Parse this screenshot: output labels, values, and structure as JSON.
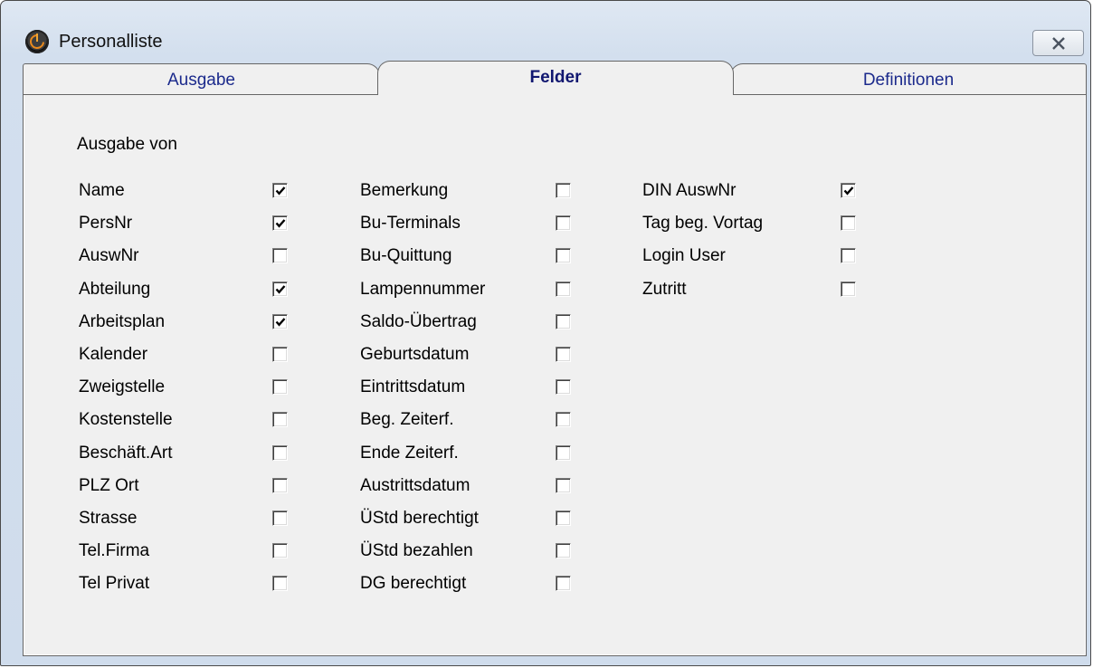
{
  "window": {
    "title": "Personalliste"
  },
  "tabs": [
    {
      "label": "Ausgabe",
      "active": false
    },
    {
      "label": "Felder",
      "active": true
    },
    {
      "label": "Definitionen",
      "active": false
    }
  ],
  "section": {
    "label": "Ausgabe von"
  },
  "columns": [
    {
      "fields": [
        {
          "label": "Name",
          "checked": true
        },
        {
          "label": "PersNr",
          "checked": true
        },
        {
          "label": "AuswNr",
          "checked": false
        },
        {
          "label": "Abteilung",
          "checked": true
        },
        {
          "label": "Arbeitsplan",
          "checked": true
        },
        {
          "label": "Kalender",
          "checked": false
        },
        {
          "label": "Zweigstelle",
          "checked": false
        },
        {
          "label": "Kostenstelle",
          "checked": false
        },
        {
          "label": "Beschäft.Art",
          "checked": false
        },
        {
          "label": "PLZ Ort",
          "checked": false
        },
        {
          "label": "Strasse",
          "checked": false
        },
        {
          "label": "Tel.Firma",
          "checked": false
        },
        {
          "label": "Tel Privat",
          "checked": false
        }
      ]
    },
    {
      "fields": [
        {
          "label": "Bemerkung",
          "checked": false
        },
        {
          "label": "Bu-Terminals",
          "checked": false
        },
        {
          "label": "Bu-Quittung",
          "checked": false
        },
        {
          "label": "Lampennummer",
          "checked": false
        },
        {
          "label": "Saldo-Übertrag",
          "checked": false
        },
        {
          "label": "Geburtsdatum",
          "checked": false
        },
        {
          "label": "Eintrittsdatum",
          "checked": false
        },
        {
          "label": "Beg. Zeiterf.",
          "checked": false
        },
        {
          "label": "Ende Zeiterf.",
          "checked": false
        },
        {
          "label": "Austrittsdatum",
          "checked": false
        },
        {
          "label": "ÜStd berechtigt",
          "checked": false
        },
        {
          "label": "ÜStd bezahlen",
          "checked": false
        },
        {
          "label": "DG berechtigt",
          "checked": false
        }
      ]
    },
    {
      "fields": [
        {
          "label": "DIN AuswNr",
          "checked": true
        },
        {
          "label": "Tag beg. Vortag",
          "checked": false
        },
        {
          "label": "Login User",
          "checked": false
        },
        {
          "label": "Zutritt",
          "checked": false
        }
      ]
    }
  ],
  "icons": {
    "app": "app-logo-icon",
    "close": "close-icon",
    "check": "check-icon"
  }
}
